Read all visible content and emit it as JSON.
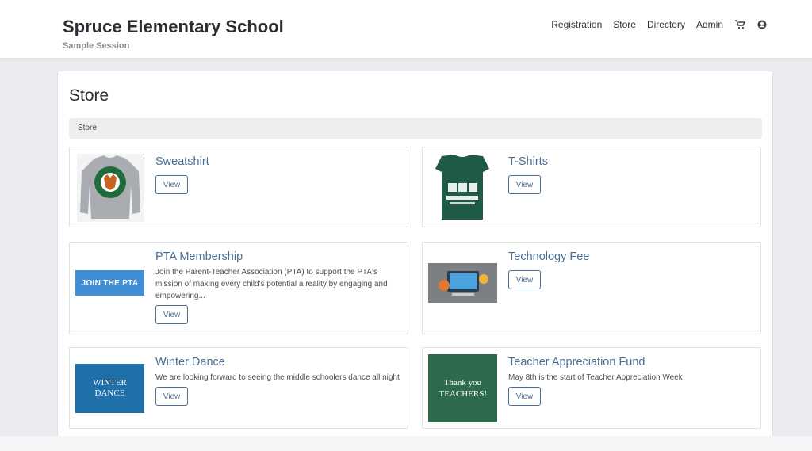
{
  "header": {
    "title": "Spruce Elementary School",
    "subtitle": "Sample Session",
    "nav": [
      "Registration",
      "Store",
      "Directory",
      "Admin"
    ],
    "icons": [
      "cart-icon",
      "user-icon"
    ]
  },
  "page": {
    "title": "Store",
    "breadcrumb": "Store"
  },
  "products": [
    {
      "name": "Sweatshirt",
      "description": "",
      "button": "View",
      "image": "sweatshirt-image"
    },
    {
      "name": "T-Shirts",
      "description": "",
      "button": "View",
      "image": "tshirt-image"
    },
    {
      "name": "PTA Membership",
      "description": "Join the Parent-Teacher Association (PTA) to support the PTA's mission of making every child's potential a reality by engaging and empowering...",
      "button": "View",
      "image": "pta-image",
      "image_text": "JOIN THE PTA"
    },
    {
      "name": "Technology Fee",
      "description": "",
      "button": "View",
      "image": "technology-image"
    },
    {
      "name": "Winter Dance",
      "description": "We are looking forward to seeing the middle schoolers dance all night",
      "button": "View",
      "image": "winter-dance-image",
      "image_text": "WINTER DANCE"
    },
    {
      "name": "Teacher Appreciation Fund",
      "description": "May 8th is the start of Teacher Appreciation Week",
      "button": "View",
      "image": "teacher-image",
      "image_text": "Thank you TEACHERS!"
    }
  ],
  "colors": {
    "link": "#4b6f93",
    "background": "#e9ebee"
  }
}
